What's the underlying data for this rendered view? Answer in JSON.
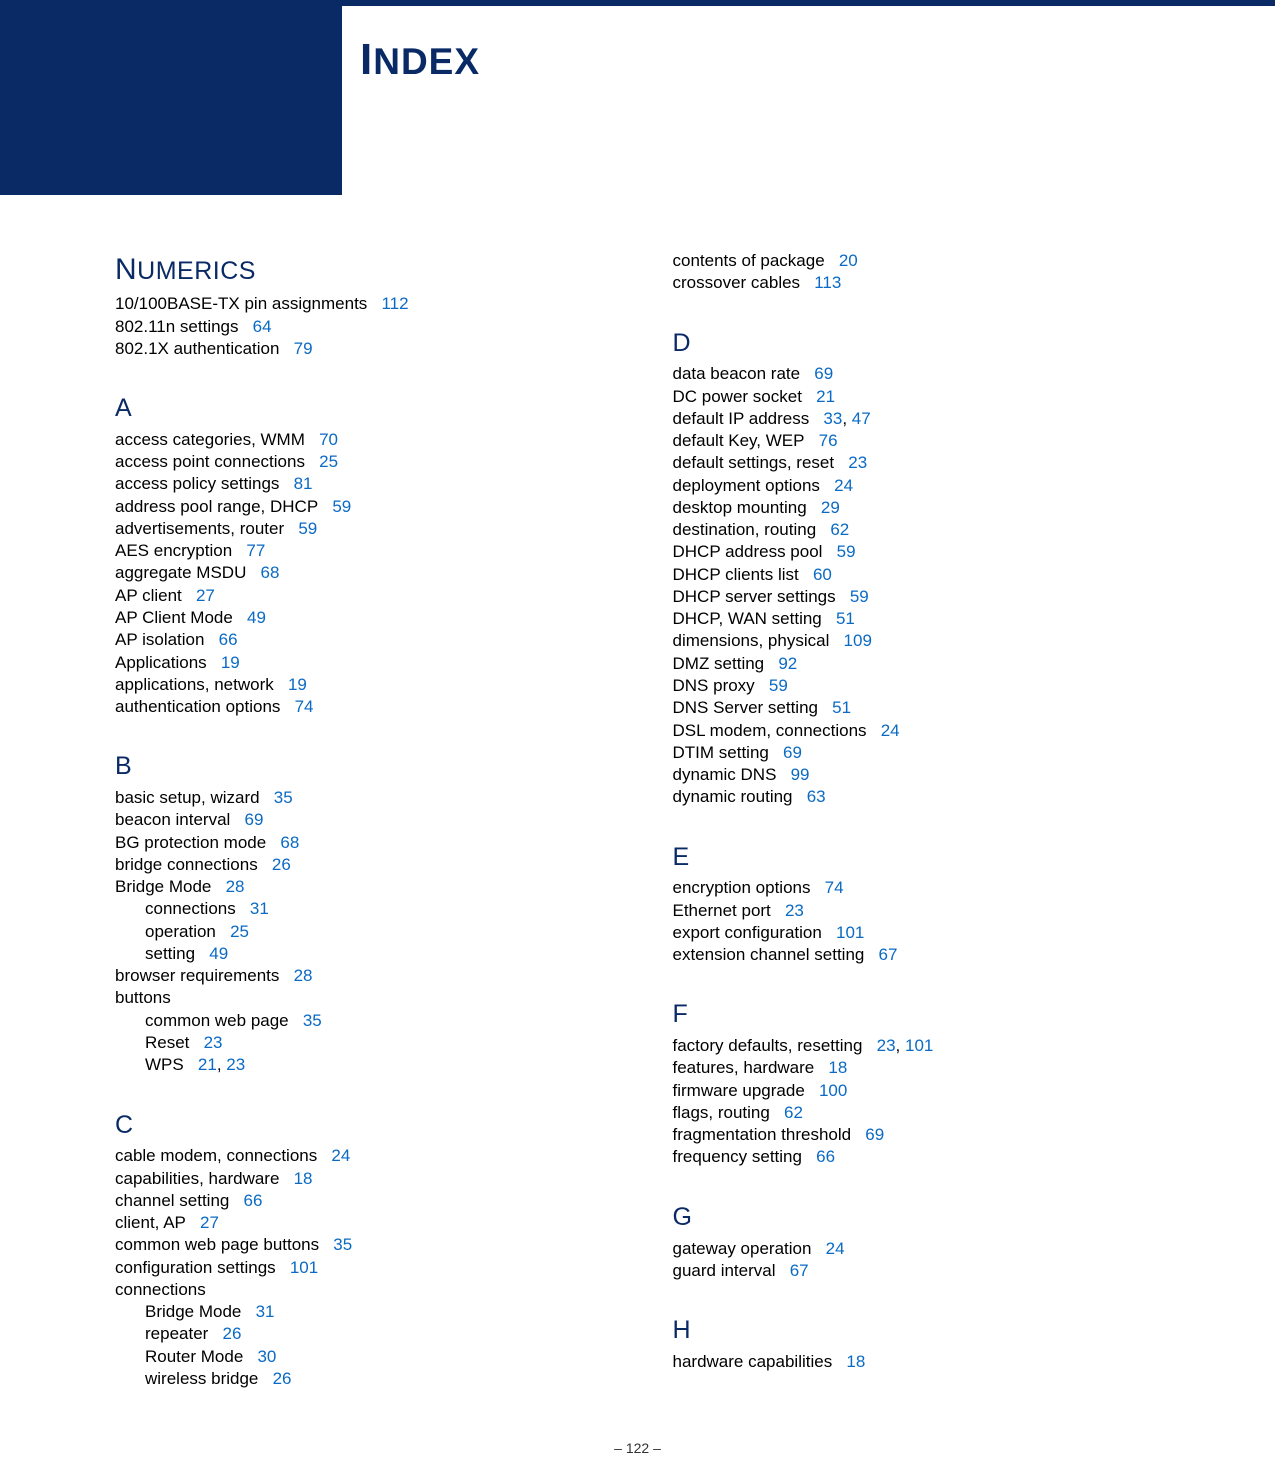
{
  "header": {
    "title_prefix": "I",
    "title_rest": "NDEX"
  },
  "sections": [
    {
      "letter": "Numerics",
      "numerics": true,
      "col": 0,
      "entries": [
        {
          "label": "10/100BASE-TX pin assignments",
          "pages": [
            "112"
          ]
        },
        {
          "label": "802.11n settings",
          "pages": [
            "64"
          ]
        },
        {
          "label": "802.1X authentication",
          "pages": [
            "79"
          ]
        }
      ]
    },
    {
      "letter": "A",
      "col": 0,
      "entries": [
        {
          "label": "access categories, WMM",
          "pages": [
            "70"
          ]
        },
        {
          "label": "access point connections",
          "pages": [
            "25"
          ]
        },
        {
          "label": "access policy settings",
          "pages": [
            "81"
          ]
        },
        {
          "label": "address pool range, DHCP",
          "pages": [
            "59"
          ]
        },
        {
          "label": "advertisements, router",
          "pages": [
            "59"
          ]
        },
        {
          "label": "AES encryption",
          "pages": [
            "77"
          ]
        },
        {
          "label": "aggregate MSDU",
          "pages": [
            "68"
          ]
        },
        {
          "label": "AP client",
          "pages": [
            "27"
          ]
        },
        {
          "label": "AP Client Mode",
          "pages": [
            "49"
          ]
        },
        {
          "label": "AP isolation",
          "pages": [
            "66"
          ]
        },
        {
          "label": "Applications",
          "pages": [
            "19"
          ]
        },
        {
          "label": "applications, network",
          "pages": [
            "19"
          ]
        },
        {
          "label": "authentication options",
          "pages": [
            "74"
          ]
        }
      ]
    },
    {
      "letter": "B",
      "col": 0,
      "entries": [
        {
          "label": "basic setup, wizard",
          "pages": [
            "35"
          ]
        },
        {
          "label": "beacon interval",
          "pages": [
            "69"
          ]
        },
        {
          "label": "BG protection mode",
          "pages": [
            "68"
          ]
        },
        {
          "label": "bridge connections",
          "pages": [
            "26"
          ]
        },
        {
          "label": "Bridge Mode",
          "pages": [
            "28"
          ]
        },
        {
          "label": "connections",
          "pages": [
            "31"
          ],
          "sub": true
        },
        {
          "label": "operation",
          "pages": [
            "25"
          ],
          "sub": true
        },
        {
          "label": "setting",
          "pages": [
            "49"
          ],
          "sub": true
        },
        {
          "label": "browser requirements",
          "pages": [
            "28"
          ]
        },
        {
          "label": "buttons",
          "pages": []
        },
        {
          "label": "common web page",
          "pages": [
            "35"
          ],
          "sub": true
        },
        {
          "label": "Reset",
          "pages": [
            "23"
          ],
          "sub": true
        },
        {
          "label": "WPS",
          "pages": [
            "21",
            "23"
          ],
          "sub": true
        }
      ]
    },
    {
      "letter": "C",
      "col": 0,
      "entries": [
        {
          "label": "cable modem, connections",
          "pages": [
            "24"
          ]
        },
        {
          "label": "capabilities, hardware",
          "pages": [
            "18"
          ]
        },
        {
          "label": "channel setting",
          "pages": [
            "66"
          ]
        },
        {
          "label": "client, AP",
          "pages": [
            "27"
          ]
        },
        {
          "label": "common web page buttons",
          "pages": [
            "35"
          ]
        },
        {
          "label": "configuration settings",
          "pages": [
            "101"
          ]
        },
        {
          "label": "connections",
          "pages": []
        },
        {
          "label": "Bridge Mode",
          "pages": [
            "31"
          ],
          "sub": true
        },
        {
          "label": "repeater",
          "pages": [
            "26"
          ],
          "sub": true
        },
        {
          "label": "Router Mode",
          "pages": [
            "30"
          ],
          "sub": true
        },
        {
          "label": "wireless bridge",
          "pages": [
            "26"
          ],
          "sub": true
        }
      ]
    },
    {
      "letter": "",
      "cont": true,
      "col": 1,
      "entries": [
        {
          "label": "contents of package",
          "pages": [
            "20"
          ]
        },
        {
          "label": "crossover cables",
          "pages": [
            "113"
          ]
        }
      ]
    },
    {
      "letter": "D",
      "col": 1,
      "entries": [
        {
          "label": "data beacon rate",
          "pages": [
            "69"
          ]
        },
        {
          "label": "DC power socket",
          "pages": [
            "21"
          ]
        },
        {
          "label": "default IP address",
          "pages": [
            "33",
            "47"
          ]
        },
        {
          "label": "default Key, WEP",
          "pages": [
            "76"
          ]
        },
        {
          "label": "default settings, reset",
          "pages": [
            "23"
          ]
        },
        {
          "label": "deployment options",
          "pages": [
            "24"
          ]
        },
        {
          "label": "desktop mounting",
          "pages": [
            "29"
          ]
        },
        {
          "label": "destination, routing",
          "pages": [
            "62"
          ]
        },
        {
          "label": "DHCP address pool",
          "pages": [
            "59"
          ]
        },
        {
          "label": "DHCP clients list",
          "pages": [
            "60"
          ]
        },
        {
          "label": "DHCP server settings",
          "pages": [
            "59"
          ]
        },
        {
          "label": "DHCP, WAN setting",
          "pages": [
            "51"
          ]
        },
        {
          "label": "dimensions, physical",
          "pages": [
            "109"
          ]
        },
        {
          "label": "DMZ setting",
          "pages": [
            "92"
          ]
        },
        {
          "label": "DNS proxy",
          "pages": [
            "59"
          ]
        },
        {
          "label": "DNS Server setting",
          "pages": [
            "51"
          ]
        },
        {
          "label": "DSL modem, connections",
          "pages": [
            "24"
          ]
        },
        {
          "label": "DTIM setting",
          "pages": [
            "69"
          ]
        },
        {
          "label": "dynamic DNS",
          "pages": [
            "99"
          ]
        },
        {
          "label": "dynamic routing",
          "pages": [
            "63"
          ]
        }
      ]
    },
    {
      "letter": "E",
      "col": 1,
      "entries": [
        {
          "label": "encryption options",
          "pages": [
            "74"
          ]
        },
        {
          "label": "Ethernet port",
          "pages": [
            "23"
          ]
        },
        {
          "label": "export configuration",
          "pages": [
            "101"
          ]
        },
        {
          "label": "extension channel setting",
          "pages": [
            "67"
          ]
        }
      ]
    },
    {
      "letter": "F",
      "col": 1,
      "entries": [
        {
          "label": "factory defaults, resetting",
          "pages": [
            "23",
            "101"
          ]
        },
        {
          "label": "features, hardware",
          "pages": [
            "18"
          ]
        },
        {
          "label": "firmware upgrade",
          "pages": [
            "100"
          ]
        },
        {
          "label": "flags, routing",
          "pages": [
            "62"
          ]
        },
        {
          "label": "fragmentation threshold",
          "pages": [
            "69"
          ]
        },
        {
          "label": "frequency setting",
          "pages": [
            "66"
          ]
        }
      ]
    },
    {
      "letter": "G",
      "col": 1,
      "entries": [
        {
          "label": "gateway operation",
          "pages": [
            "24"
          ]
        },
        {
          "label": "guard interval",
          "pages": [
            "67"
          ]
        }
      ]
    },
    {
      "letter": "H",
      "col": 1,
      "entries": [
        {
          "label": "hardware capabilities",
          "pages": [
            "18"
          ]
        }
      ]
    }
  ],
  "footer": {
    "page_num": "–  122  –"
  }
}
